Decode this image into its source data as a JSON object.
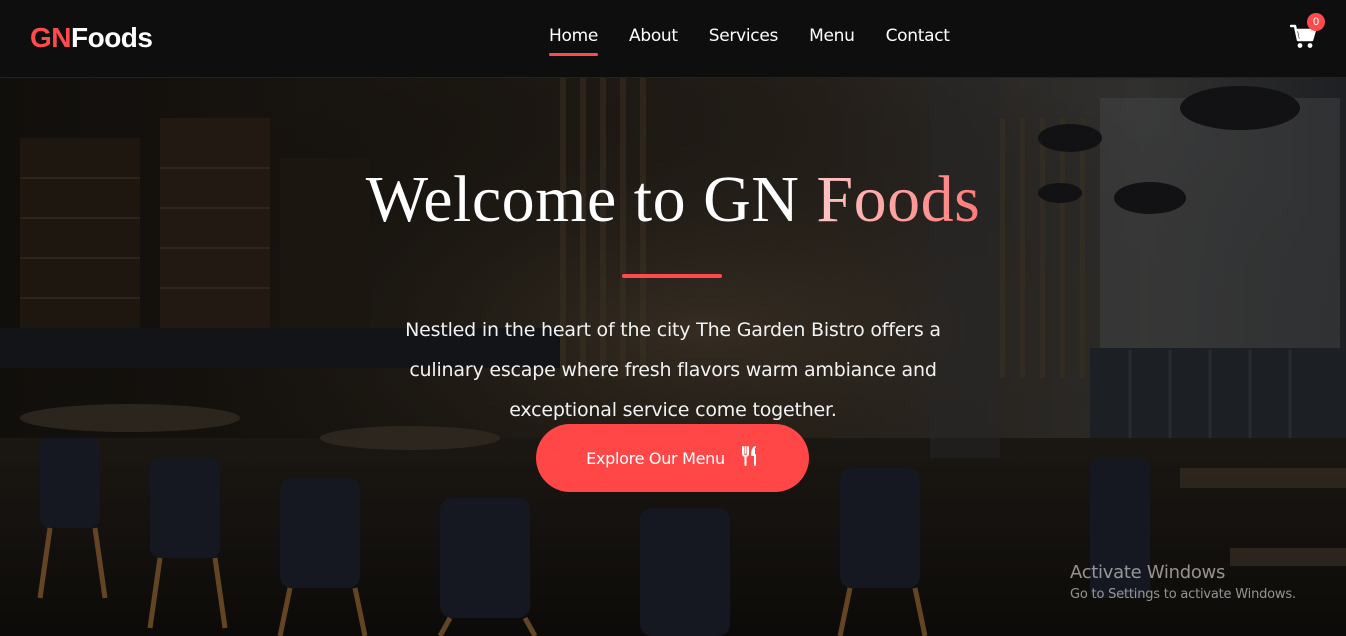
{
  "brand": {
    "part1": "GN",
    "part2": "Foods"
  },
  "nav": [
    {
      "label": "Home",
      "active": true
    },
    {
      "label": "About",
      "active": false
    },
    {
      "label": "Services",
      "active": false
    },
    {
      "label": "Menu",
      "active": false
    },
    {
      "label": "Contact",
      "active": false
    }
  ],
  "cart": {
    "icon": "shopping-cart-icon",
    "count": "0"
  },
  "hero": {
    "title_main": "Welcome to GN ",
    "title_accent": "Foods",
    "description": "Nestled in the heart of the city The Garden Bistro offers a culinary escape where fresh flavors warm ambiance and exceptional service come together.",
    "cta_label": "Explore Our Menu",
    "cta_icon": "utensils-icon"
  },
  "watermark": {
    "line1": "Activate Windows",
    "line2": "Go to Settings to activate Windows."
  },
  "colors": {
    "accent": "#ff4b4b",
    "nav_bg": "#0f0e0e"
  }
}
